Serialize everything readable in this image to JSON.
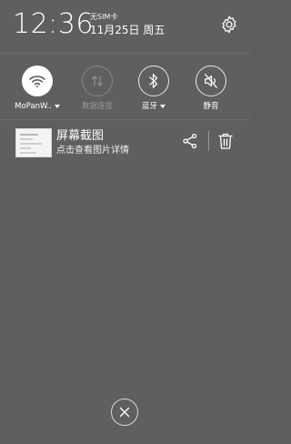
{
  "header": {
    "time": "12:36",
    "sim_status": "无SIM卡",
    "date": "11月25日 周五",
    "settings_icon": "gear-icon"
  },
  "quick_toggles": [
    {
      "id": "wifi",
      "label": "MoPanW..",
      "icon": "wifi-icon",
      "state": "on",
      "has_dropdown": true
    },
    {
      "id": "data",
      "label": "数据连接",
      "icon": "data-arrows-icon",
      "state": "disabled",
      "has_dropdown": false
    },
    {
      "id": "bluetooth",
      "label": "蓝牙",
      "icon": "bluetooth-icon",
      "state": "off",
      "has_dropdown": true
    },
    {
      "id": "mute",
      "label": "静音",
      "icon": "mute-icon",
      "state": "off",
      "has_dropdown": false
    }
  ],
  "notification": {
    "title": "屏幕截图",
    "subtitle": "点击查看图片详情",
    "actions": [
      "share-icon",
      "trash-icon"
    ]
  },
  "close_icon": "close-icon",
  "colors": {
    "background": "#5f5f5f",
    "text": "#ffffff",
    "active_toggle": "#ffffff",
    "active_icon": "#555555"
  }
}
